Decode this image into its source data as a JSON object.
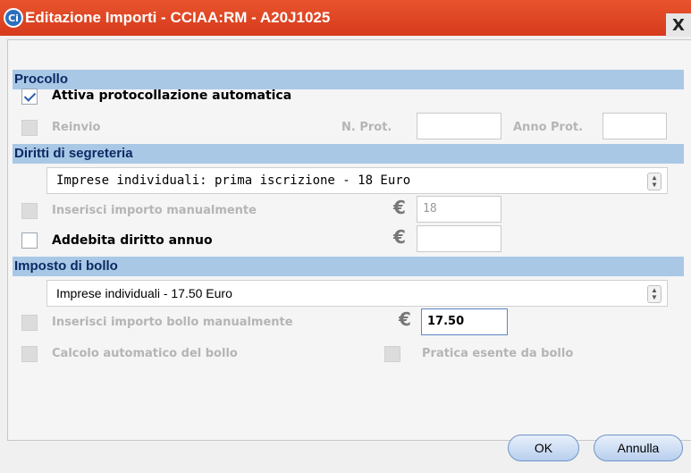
{
  "window": {
    "title": "Editazione Importi - CCIAA:RM - A20J1025",
    "icon_label": "Ci",
    "close_label": "X"
  },
  "protocollo": {
    "header": "Procollo",
    "attiva_label": "Attiva protocollazione automatica",
    "attiva_checked": true,
    "reinvio_label": "Reinvio",
    "nprot_label": "N. Prot.",
    "nprot_value": "",
    "annoprot_label": "Anno Prot.",
    "annoprot_value": ""
  },
  "diritti": {
    "header": "Diritti di segreteria",
    "select_value": "Imprese individuali: prima iscrizione - 18 Euro",
    "manual_label": "Inserisci importo manualmente",
    "manual_value": "18",
    "euro_symbol": "€",
    "addebita_label": "Addebita diritto annuo",
    "addebita_value": ""
  },
  "bollo": {
    "header": "Imposto di bollo",
    "select_value": "Imprese individuali - 17.50 Euro",
    "manual_label": "Inserisci importo bollo manualmente",
    "manual_value": "17.50",
    "calcolo_label": "Calcolo automatico del bollo",
    "esente_label": "Pratica esente da bollo"
  },
  "buttons": {
    "ok": "OK",
    "annulla": "Annulla"
  }
}
